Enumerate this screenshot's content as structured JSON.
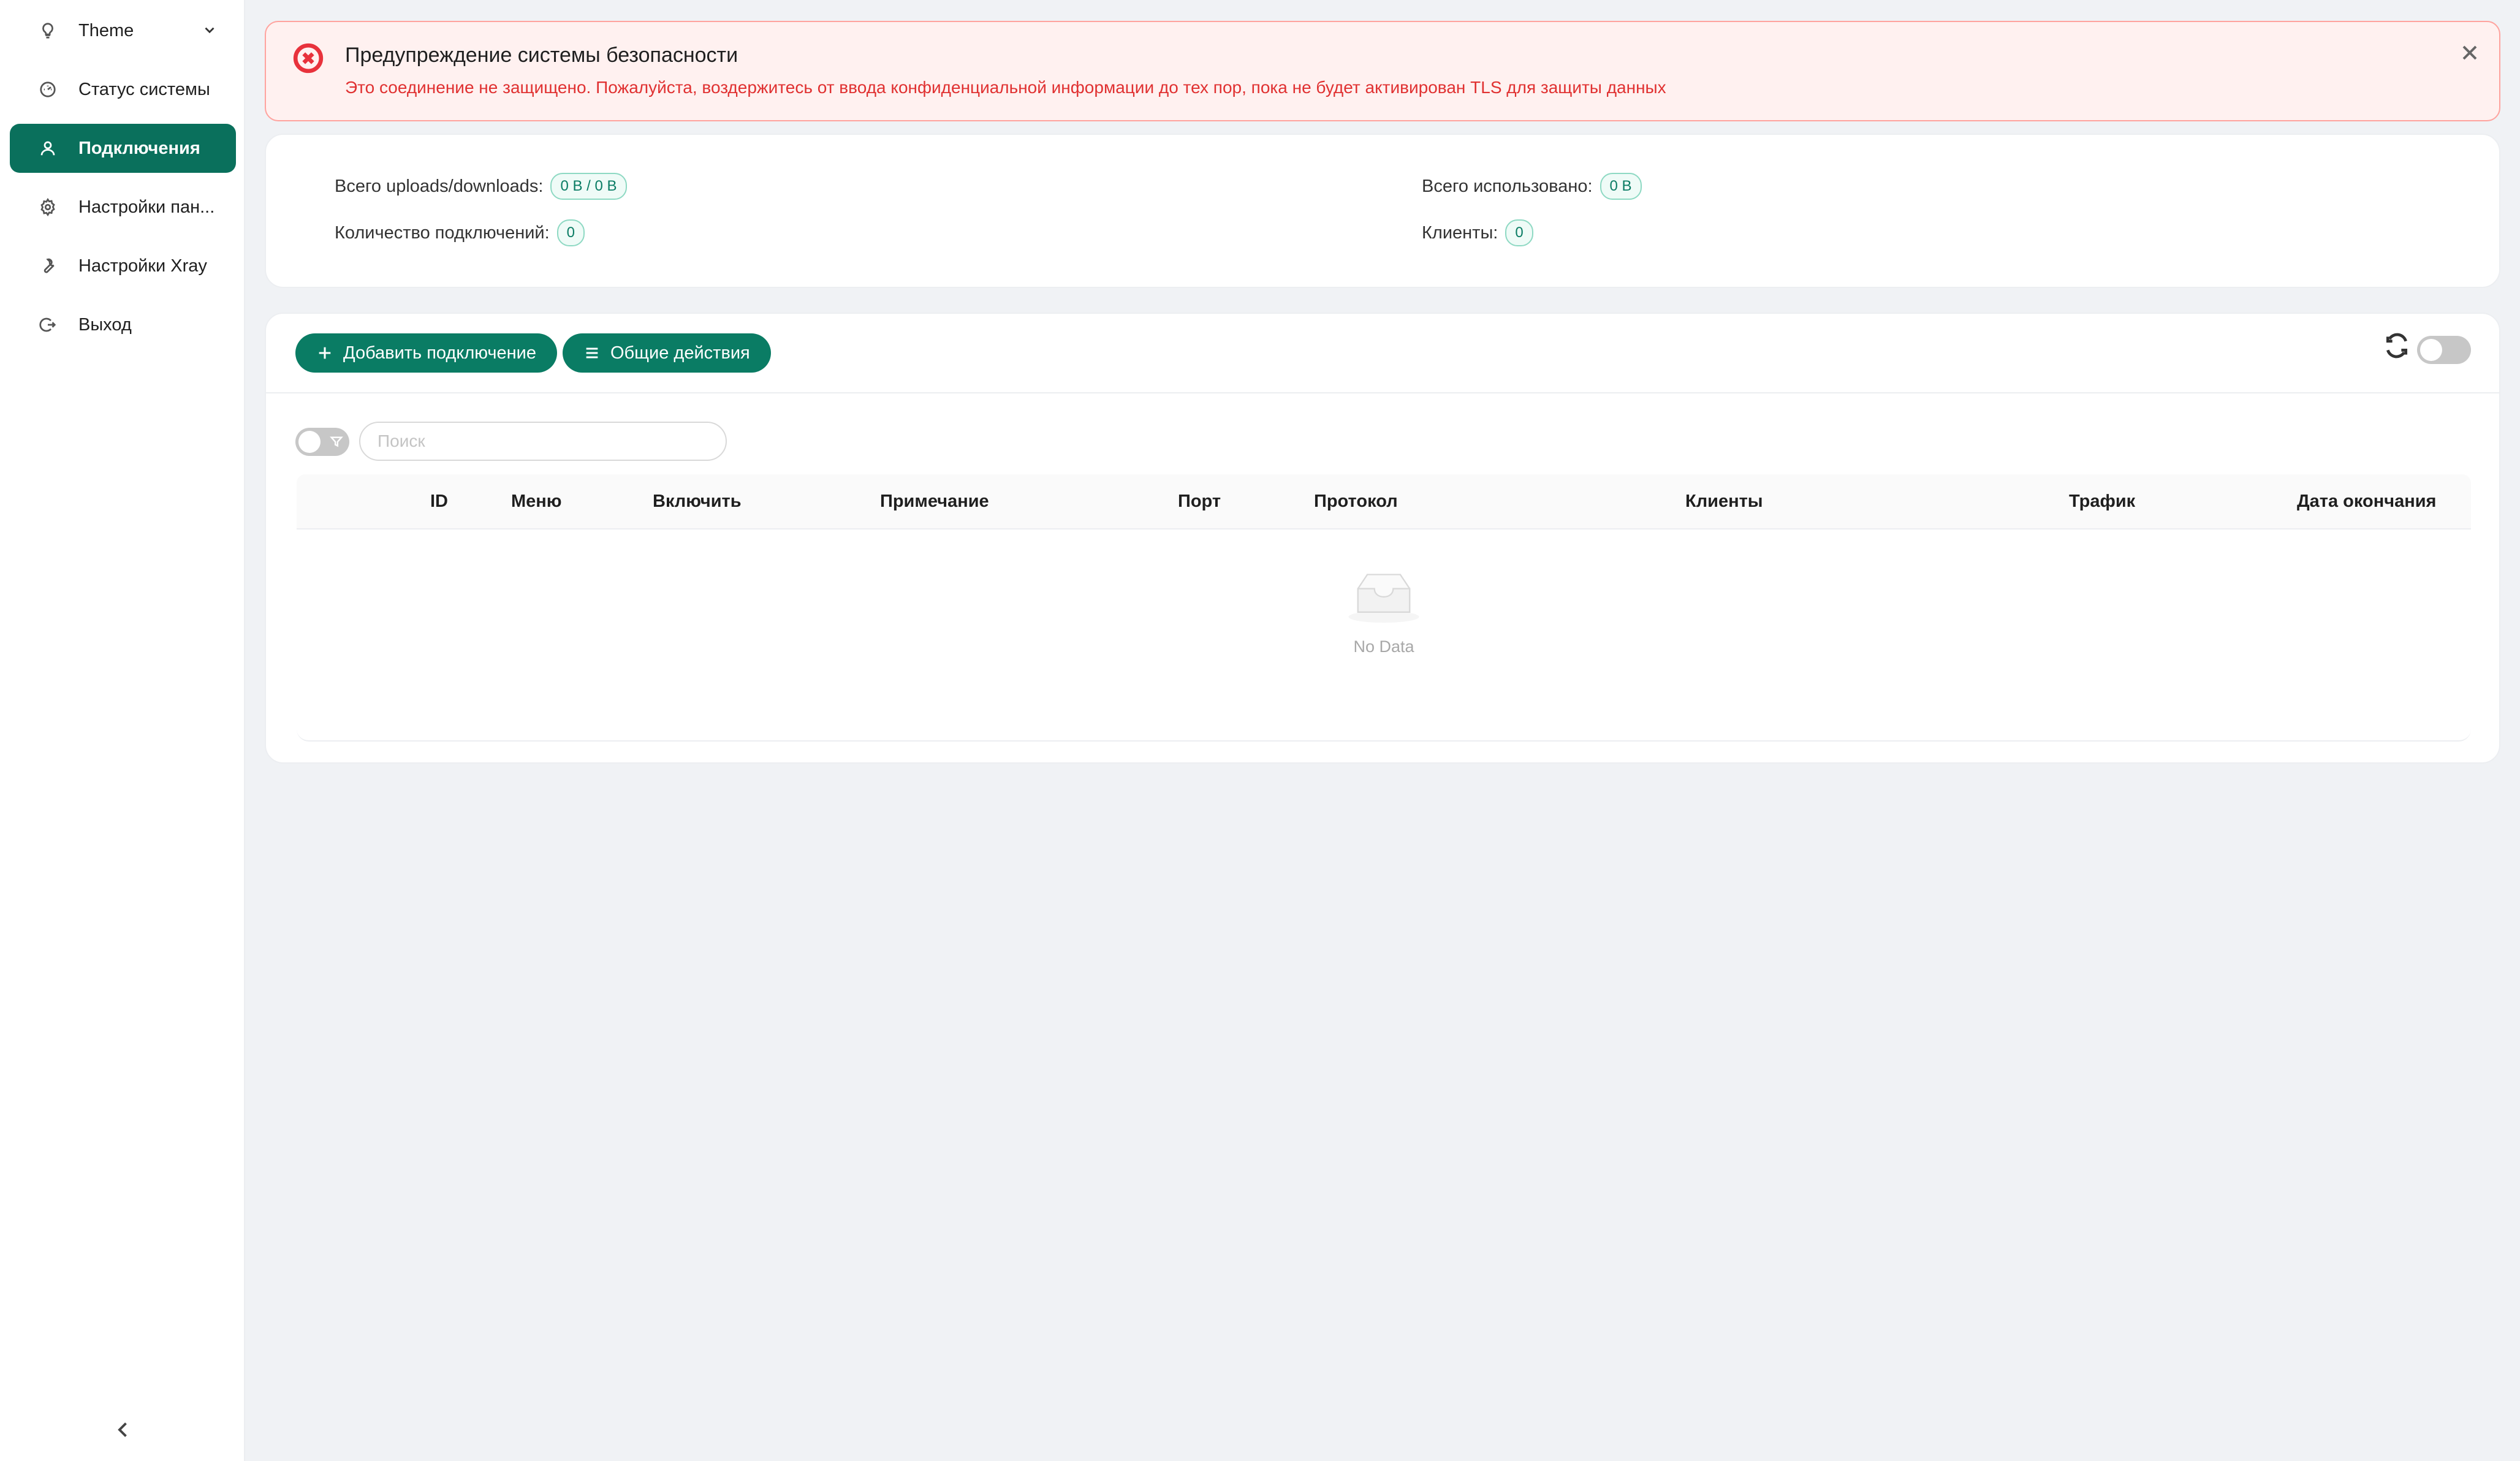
{
  "sidebar": {
    "items": [
      {
        "label": "Theme",
        "icon": "bulb-icon"
      },
      {
        "label": "Статус системы",
        "icon": "dashboard-icon"
      },
      {
        "label": "Подключения",
        "icon": "user-icon",
        "active": true
      },
      {
        "label": "Настройки пан...",
        "icon": "gear-icon"
      },
      {
        "label": "Настройки Xray",
        "icon": "tool-icon"
      },
      {
        "label": "Выход",
        "icon": "logout-icon"
      }
    ]
  },
  "alert": {
    "title": "Предупреждение системы безопасности",
    "description": "Это соединение не защищено. Пожалуйста, воздержитесь от ввода конфиденциальной информации до тех пор, пока не будет активирован TLS для защиты данных"
  },
  "stats": {
    "total_updown_label": "Всего uploads/downloads:",
    "total_updown_value": "0 B / 0 B",
    "total_used_label": "Всего использовано:",
    "total_used_value": "0 B",
    "connections_count_label": "Количество подключений:",
    "connections_count_value": "0",
    "clients_label": "Клиенты:",
    "clients_value": "0"
  },
  "toolbar": {
    "add_connection": "Добавить подключение",
    "general_actions": "Общие действия"
  },
  "search": {
    "placeholder": "Поиск"
  },
  "table": {
    "columns": [
      "ID",
      "Меню",
      "Включить",
      "Примечание",
      "Порт",
      "Протокол",
      "Клиенты",
      "Трафик",
      "Дата окончания"
    ],
    "rows": [],
    "empty_text": "No Data"
  },
  "colors": {
    "primary": "#0a7c64",
    "alert_bg": "#fff1f0",
    "alert_text": "#e03131",
    "page_bg": "#f0f2f5"
  }
}
